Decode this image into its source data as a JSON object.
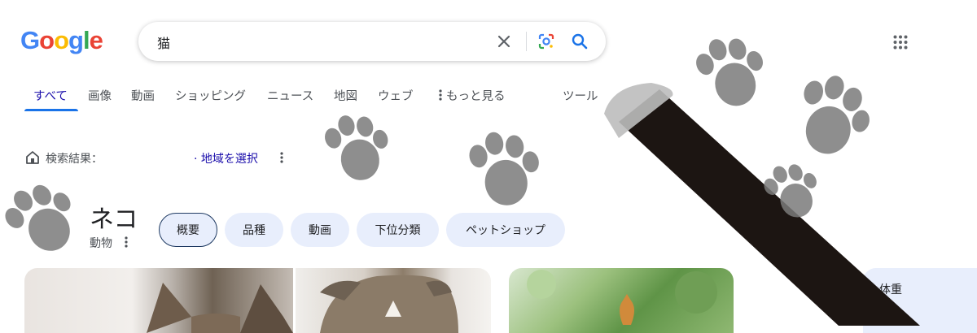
{
  "logo": {
    "letters": [
      "G",
      "o",
      "o",
      "g",
      "l",
      "e"
    ]
  },
  "search": {
    "query": "猫"
  },
  "tabs": [
    {
      "label": "すべて"
    },
    {
      "label": "画像"
    },
    {
      "label": "動画"
    },
    {
      "label": "ショッピング"
    },
    {
      "label": "ニュース"
    },
    {
      "label": "地図"
    },
    {
      "label": "ウェブ"
    },
    {
      "label": "もっと見る"
    },
    {
      "label": "ツール"
    }
  ],
  "location": {
    "label": "検索結果：",
    "link": "· 地域を選択"
  },
  "entity": {
    "title": "ネコ",
    "subtitle": "動物"
  },
  "chips": [
    {
      "label": "概要"
    },
    {
      "label": "品種"
    },
    {
      "label": "動画"
    },
    {
      "label": "下位分類"
    },
    {
      "label": "ペットショップ"
    }
  ],
  "info_card": {
    "label": "体重"
  },
  "colors": {
    "accent": "#1a73e8",
    "link": "#1a0dab",
    "chip_bg": "#e8eefc",
    "paw": "#7a7a7a",
    "stick": "#1c1512"
  },
  "icons": [
    "clear-icon",
    "lens-icon",
    "search-icon",
    "apps-grid-icon",
    "kebab-icon",
    "home-location-icon"
  ]
}
